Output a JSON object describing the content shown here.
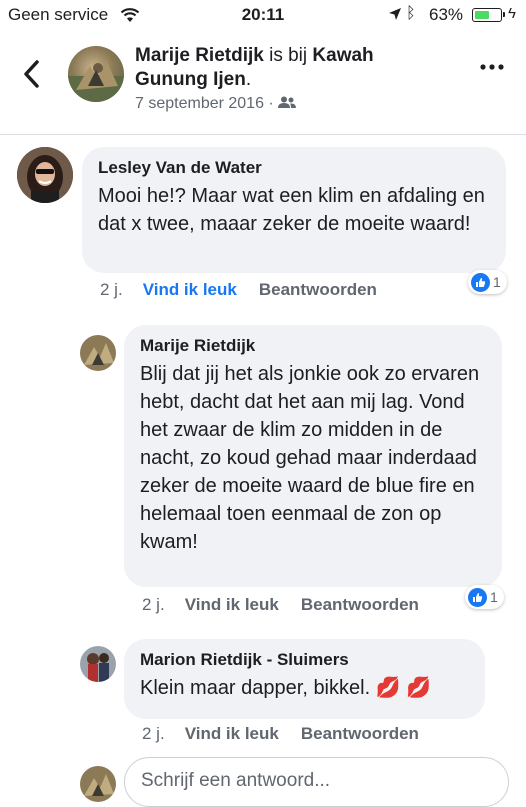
{
  "status_bar": {
    "carrier": "Geen service",
    "time": "20:11",
    "battery_percent": "63%",
    "battery_level": 0.63,
    "battery_color": "#4cd964"
  },
  "header": {
    "author": "Marije Rietdijk",
    "connector": " is bij ",
    "place": "Kawah Gunung Ijen",
    "suffix": ".",
    "date": "7 september 2016 · ",
    "audience_icon": "friends-icon"
  },
  "comments": [
    {
      "author": "Lesley Van de Water",
      "text": "Mooi he!? Maar wat een klim en afdaling en dat x twee, maaar zeker de moeite waard!",
      "age": "2 j.",
      "like_label": "Vind ik leuk",
      "reply_label": "Beantwoorden",
      "reaction_count": "1"
    },
    {
      "author": "Marije Rietdijk",
      "text": "Blij dat jij het als jonkie ook zo ervaren hebt, dacht dat het aan mij lag. Vond het zwaar de klim zo midden in de nacht, zo koud gehad maar inderdaad zeker de moeite waard de blue fire en helemaal toen eenmaal de zon op kwam!",
      "age": "2 j.",
      "like_label": "Vind ik leuk",
      "reply_label": "Beantwoorden",
      "reaction_count": "1"
    },
    {
      "author": "Marion Rietdijk - Sluimers",
      "text": "Klein maar dapper, bikkel. 💋 💋",
      "age": "2 j.",
      "like_label": "Vind ik leuk",
      "reply_label": "Beantwoorden"
    }
  ],
  "reply_box": {
    "placeholder": "Schrijf een antwoord..."
  },
  "colors": {
    "accent": "#1877f2",
    "bubble": "#f0f2f5"
  }
}
